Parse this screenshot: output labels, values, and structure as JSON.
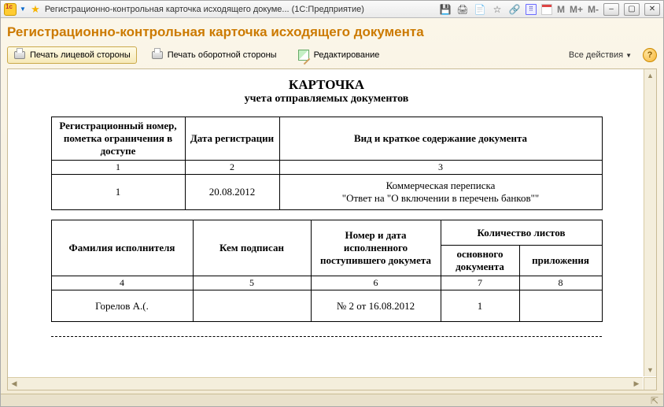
{
  "titlebar": {
    "title": "Регистрационно-контрольная карточка исходящего докуме...  (1С:Предприятие)",
    "mem_m": "M",
    "mem_mplus": "M+",
    "mem_mminus": "M-"
  },
  "page": {
    "title": "Регистрационно-контрольная карточка исходящего документа"
  },
  "toolbar": {
    "print_front": "Печать лицевой стороны",
    "print_back": "Печать оборотной стороны",
    "edit": "Редактирование",
    "all_actions": "Все действия",
    "help": "?"
  },
  "doc": {
    "title": "КАРТОЧКА",
    "subtitle": "учета отправляемых документов",
    "t1": {
      "h1": "Регистрационный номер, пометка ограничения в доступе",
      "h2": "Дата регистрации",
      "h3": "Вид и краткое содержание документа",
      "n1": "1",
      "n2": "2",
      "n3": "3",
      "v1": "1",
      "v2": "20.08.2012",
      "v3a": "Коммерческая переписка",
      "v3b": "\"Ответ на \"О включении в перечень банков\"\""
    },
    "t2": {
      "h1": "Фамилия исполнителя",
      "h2": "Кем подписан",
      "h3": "Номер и дата исполненного поступившего докумета",
      "h4": "Количество листов",
      "h4a": "основного документа",
      "h4b": "приложения",
      "n1": "4",
      "n2": "5",
      "n3": "6",
      "n4": "7",
      "n5": "8",
      "v1": "Горелов А.(.",
      "v2": "",
      "v3": "№ 2 от 16.08.2012",
      "v4": "1",
      "v5": ""
    }
  }
}
